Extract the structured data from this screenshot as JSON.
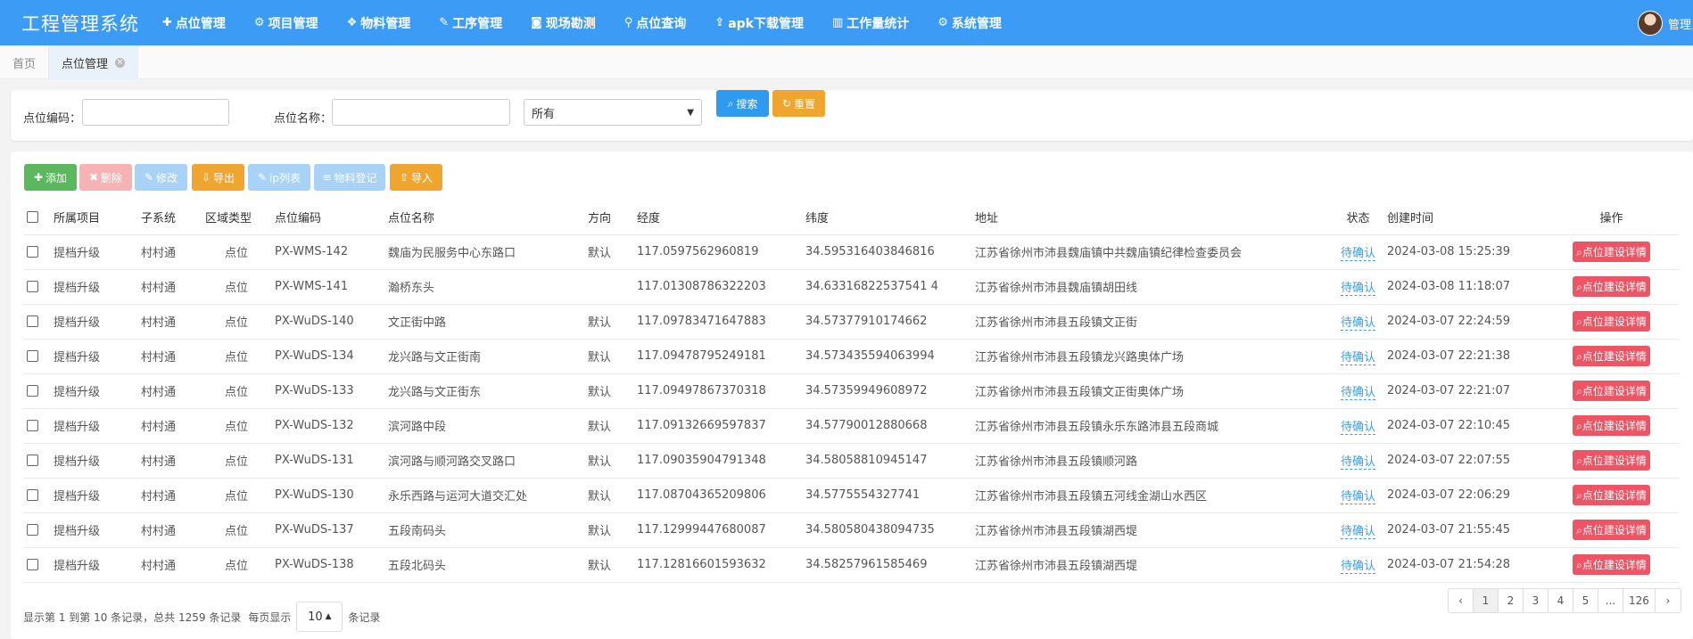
{
  "brand": "工程管理系统",
  "nav": [
    {
      "icon": "plus-icon",
      "glyph": "✚",
      "label": "点位管理"
    },
    {
      "icon": "gears-icon",
      "glyph": "⚙",
      "label": "项目管理"
    },
    {
      "icon": "cubes-icon",
      "glyph": "❖",
      "label": "物料管理"
    },
    {
      "icon": "edit-icon",
      "glyph": "✎",
      "label": "工序管理"
    },
    {
      "icon": "camera-icon",
      "glyph": "◙",
      "label": "现场勘测"
    },
    {
      "icon": "map-marker-icon",
      "glyph": "⚲",
      "label": "点位查询"
    },
    {
      "icon": "upload-icon",
      "glyph": "⇪",
      "label": "apk下载管理"
    },
    {
      "icon": "bar-chart-icon",
      "glyph": "▥",
      "label": "工作量统计"
    },
    {
      "icon": "gear-icon",
      "glyph": "⚙",
      "label": "系统管理"
    }
  ],
  "user": {
    "name": "管理员"
  },
  "tabs": [
    {
      "label": "首页"
    },
    {
      "label": "点位管理"
    }
  ],
  "search": {
    "code_label": "点位编码：",
    "name_label": "点位名称：",
    "code_value": "",
    "name_value": "",
    "select_value": "所有",
    "search_button": "搜索",
    "reset_button": "重置"
  },
  "toolbar": {
    "add": "添加",
    "delete": "删除",
    "edit": "修改",
    "export": "导出",
    "ip_list": "ip列表",
    "material": "物料登记",
    "import": "导入"
  },
  "table": {
    "headers": [
      "所属项目",
      "子系统",
      "区域类型",
      "点位编码",
      "点位名称",
      "方向",
      "经度",
      "纬度",
      "地址",
      "状态",
      "创建时间",
      "操作"
    ],
    "rows": [
      {
        "project": "提档升级",
        "subsystem": "村村通",
        "area": "点位",
        "code": "PX-WMS-142",
        "name": "魏庙为民服务中心东路口",
        "direction": "默认",
        "lng": "117.0597562960819",
        "lat": "34.595316403846816",
        "address": "江苏省徐州市沛县魏庙镇中共魏庙镇纪律检查委员会",
        "status": "待确认",
        "created": "2024-03-08 15:25:39",
        "action": "点位建设详情"
      },
      {
        "project": "提档升级",
        "subsystem": "村村通",
        "area": "点位",
        "code": "PX-WMS-141",
        "name": "瀚桥东头",
        "direction": "",
        "lng": "117.01308786322203",
        "lat": "34.63316822537541 4",
        "address": "江苏省徐州市沛县魏庙镇胡田线",
        "status": "待确认",
        "created": "2024-03-08 11:18:07",
        "action": "点位建设详情"
      },
      {
        "project": "提档升级",
        "subsystem": "村村通",
        "area": "点位",
        "code": "PX-WuDS-140",
        "name": "文正街中路",
        "direction": "默认",
        "lng": "117.09783471647883",
        "lat": "34.57377910174662",
        "address": "江苏省徐州市沛县五段镇文正街",
        "status": "待确认",
        "created": "2024-03-07 22:24:59",
        "action": "点位建设详情"
      },
      {
        "project": "提档升级",
        "subsystem": "村村通",
        "area": "点位",
        "code": "PX-WuDS-134",
        "name": "龙兴路与文正街南",
        "direction": "默认",
        "lng": "117.09478795249181",
        "lat": "34.573435594063994",
        "address": "江苏省徐州市沛县五段镇龙兴路奥体广场",
        "status": "待确认",
        "created": "2024-03-07 22:21:38",
        "action": "点位建设详情"
      },
      {
        "project": "提档升级",
        "subsystem": "村村通",
        "area": "点位",
        "code": "PX-WuDS-133",
        "name": "龙兴路与文正街东",
        "direction": "默认",
        "lng": "117.09497867370318",
        "lat": "34.57359949608972",
        "address": "江苏省徐州市沛县五段镇文正街奥体广场",
        "status": "待确认",
        "created": "2024-03-07 22:21:07",
        "action": "点位建设详情"
      },
      {
        "project": "提档升级",
        "subsystem": "村村通",
        "area": "点位",
        "code": "PX-WuDS-132",
        "name": "滨河路中段",
        "direction": "默认",
        "lng": "117.09132669597837",
        "lat": "34.57790012880668",
        "address": "江苏省徐州市沛县五段镇永乐东路沛县五段商城",
        "status": "待确认",
        "created": "2024-03-07 22:10:45",
        "action": "点位建设详情"
      },
      {
        "project": "提档升级",
        "subsystem": "村村通",
        "area": "点位",
        "code": "PX-WuDS-131",
        "name": "滨河路与顺河路交叉路口",
        "direction": "默认",
        "lng": "117.09035904791348",
        "lat": "34.58058810945147",
        "address": "江苏省徐州市沛县五段镇顺河路",
        "status": "待确认",
        "created": "2024-03-07 22:07:55",
        "action": "点位建设详情"
      },
      {
        "project": "提档升级",
        "subsystem": "村村通",
        "area": "点位",
        "code": "PX-WuDS-130",
        "name": "永乐西路与运河大道交汇处",
        "direction": "默认",
        "lng": "117.08704365209806",
        "lat": "34.5775554327741",
        "address": "江苏省徐州市沛县五段镇五河线金湖山水西区",
        "status": "待确认",
        "created": "2024-03-07 22:06:29",
        "action": "点位建设详情"
      },
      {
        "project": "提档升级",
        "subsystem": "村村通",
        "area": "点位",
        "code": "PX-WuDS-137",
        "name": "五段南码头",
        "direction": "默认",
        "lng": "117.12999447680087",
        "lat": "34.580580438094735",
        "address": "江苏省徐州市沛县五段镇湖西堤",
        "status": "待确认",
        "created": "2024-03-07 21:55:45",
        "action": "点位建设详情"
      },
      {
        "project": "提档升级",
        "subsystem": "村村通",
        "area": "点位",
        "code": "PX-WuDS-138",
        "name": "五段北码头",
        "direction": "默认",
        "lng": "117.12816601593632",
        "lat": "34.58257961585469",
        "address": "江苏省徐州市沛县五段镇湖西堤",
        "status": "待确认",
        "created": "2024-03-07 21:54:28",
        "action": "点位建设详情"
      }
    ]
  },
  "footer": {
    "summary": "显示第 1 到第 10 条记录，总共 1259 条记录",
    "per_page_prefix": "每页显示",
    "per_page_value": "10",
    "per_page_suffix": "条记录"
  },
  "pagination": [
    "‹",
    "1",
    "2",
    "3",
    "4",
    "5",
    "...",
    "126",
    "›"
  ],
  "colors": {
    "topbar": "#3c9cf5",
    "danger": "#ed5565",
    "warning": "#f0a52e",
    "success": "#5cb85c"
  }
}
